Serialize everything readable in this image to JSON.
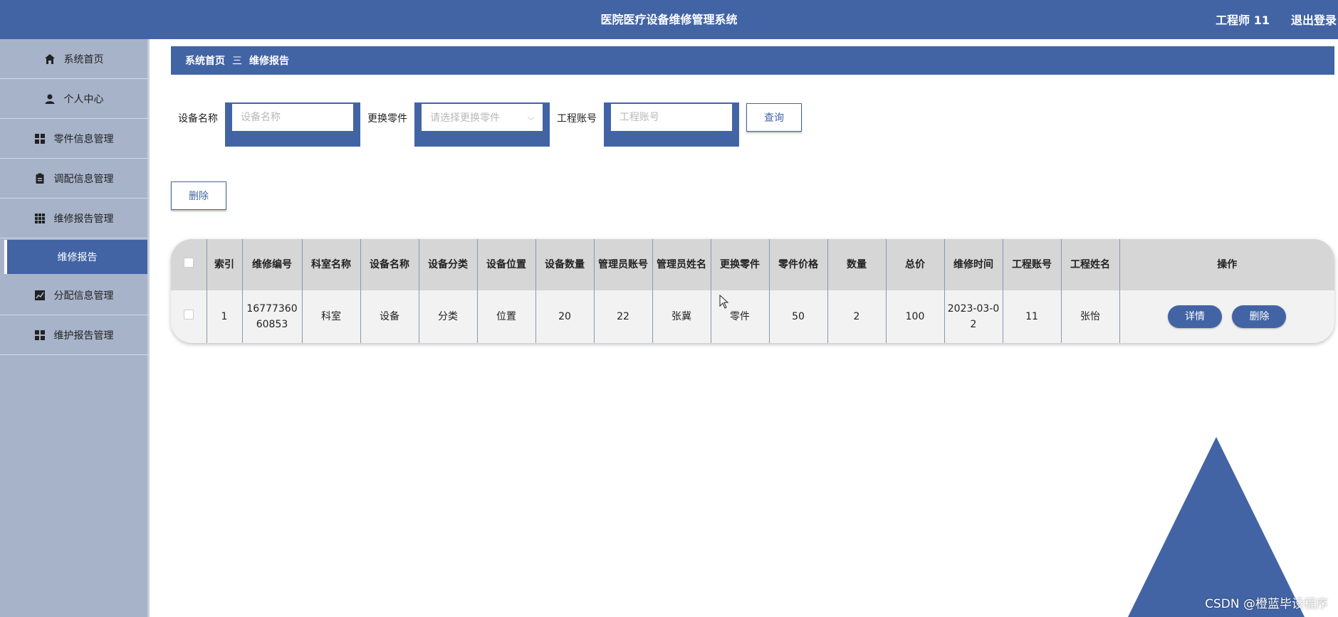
{
  "header": {
    "title": "医院医疗设备维修管理系统",
    "user": "工程师 11",
    "logout": "退出登录"
  },
  "sidebar": {
    "items": [
      {
        "label": "系统首页",
        "icon": "home-icon"
      },
      {
        "label": "个人中心",
        "icon": "user-icon"
      },
      {
        "label": "零件信息管理",
        "icon": "grid-icon"
      },
      {
        "label": "调配信息管理",
        "icon": "clipboard-icon"
      },
      {
        "label": "维修报告管理",
        "icon": "apps-icon"
      },
      {
        "label": "维修报告",
        "sub": true
      },
      {
        "label": "分配信息管理",
        "icon": "chart-icon"
      },
      {
        "label": "维护报告管理",
        "icon": "grid-icon"
      }
    ]
  },
  "breadcrumb": {
    "home": "系统首页",
    "separator": "三",
    "current": "维修报告"
  },
  "search": {
    "device_label": "设备名称",
    "device_placeholder": "设备名称",
    "part_label": "更换零件",
    "part_placeholder": "请选择更换零件",
    "account_label": "工程账号",
    "account_placeholder": "工程账号",
    "query_button": "查询"
  },
  "toolbar": {
    "delete_button": "删除"
  },
  "table": {
    "headers": [
      "索引",
      "维修编号",
      "科室名称",
      "设备名称",
      "设备分类",
      "设备位置",
      "设备数量",
      "管理员账号",
      "管理员姓名",
      "更换零件",
      "零件价格",
      "数量",
      "总价",
      "维修时间",
      "工程账号",
      "工程姓名",
      "操作"
    ],
    "rows": [
      [
        "1",
        "1677736060853",
        "科室",
        "设备",
        "分类",
        "位置",
        "20",
        "22",
        "张冀",
        "零件",
        "50",
        "2",
        "100",
        "2023-03-02",
        "11",
        "张怡"
      ]
    ],
    "actions": {
      "detail": "详情",
      "delete": "删除"
    }
  },
  "watermark": "CSDN @橙蓝毕设程序",
  "colors": {
    "primary": "#4264a5",
    "sidebar": "#a7b3c9",
    "header_row": "#d6d6d6",
    "body_row": "#f2f2f2"
  }
}
